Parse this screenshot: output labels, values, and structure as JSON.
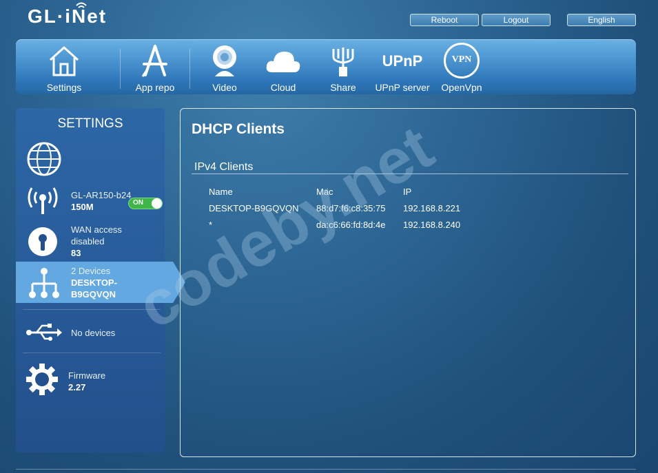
{
  "header": {
    "logo_text": "GL·iNet",
    "buttons": {
      "reboot": "Reboot",
      "logout": "Logout",
      "language": "English"
    }
  },
  "nav": {
    "items": [
      {
        "label": "Settings",
        "icon": "home-icon"
      },
      {
        "label": "App repo",
        "icon": "app-store-icon"
      },
      {
        "label": "Video",
        "icon": "webcam-icon"
      },
      {
        "label": "Cloud",
        "icon": "cloud-icon"
      },
      {
        "label": "Share",
        "icon": "usb-share-icon"
      },
      {
        "label": "UPnP server",
        "icon": "upnp-icon"
      },
      {
        "label": "OpenVpn",
        "icon": "vpn-icon"
      }
    ],
    "upnp_icon_text": "UPnP",
    "vpn_icon_text": "VPN"
  },
  "sidebar": {
    "title": "SETTINGS",
    "wifi": {
      "ssid": "GL-AR150-b24",
      "speed": "150M",
      "toggle": "ON"
    },
    "wan": {
      "line1": "WAN access",
      "line2": "disabled",
      "value": "83"
    },
    "devices": {
      "count": "2 Devices",
      "name_line1": "DESKTOP-",
      "name_line2": "B9GQVQN"
    },
    "usb": {
      "text": "No devices"
    },
    "firmware": {
      "label": "Firmware",
      "version": "2.27"
    }
  },
  "main": {
    "title": "DHCP Clients",
    "section": "IPv4 Clients",
    "columns": {
      "name": "Name",
      "mac": "Mac",
      "ip": "IP"
    },
    "rows": [
      {
        "name": "DESKTOP-B9GQVQN",
        "mac": "88:d7:f6:c8:35:75",
        "ip": "192.168.8.221"
      },
      {
        "name": "*",
        "mac": "da:c6:66:fd:8d:4e",
        "ip": "192.168.8.240"
      }
    ]
  },
  "watermark": "codeby.net",
  "colors": {
    "toggle_on": "#3fb54a",
    "active_item": "#63a8e0",
    "nav_bar": "#4a93cf"
  }
}
